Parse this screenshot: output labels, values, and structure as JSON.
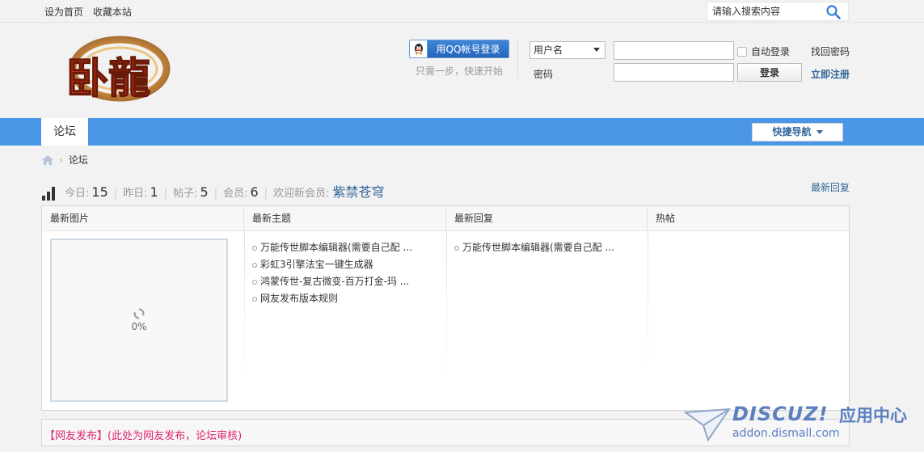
{
  "topbar": {
    "links": [
      "设为首页",
      "收藏本站"
    ],
    "search_placeholder": "请输入搜索内容"
  },
  "header": {
    "logo_text": "卧龍",
    "qq_login_label": "用QQ帐号登录",
    "qq_hint": "只需一步，快速开始",
    "username_select": "用户名",
    "password_label": "密码",
    "auto_login_label": "自动登录",
    "login_button": "登录",
    "find_password": "找回密码",
    "register": "立即注册"
  },
  "nav": {
    "tab": "论坛",
    "quick_nav": "快捷导航"
  },
  "breadcrumb": {
    "current": "论坛"
  },
  "stats": {
    "today_label": "今日:",
    "today": "15",
    "yesterday_label": "昨日:",
    "yesterday": "1",
    "posts_label": "帖子:",
    "posts": "5",
    "members_label": "会员:",
    "members": "6",
    "welcome_label": "欢迎新会员:",
    "new_member": "紫禁苍穹",
    "latest_reply_link": "最新回复"
  },
  "panel": {
    "columns": [
      "最新图片",
      "最新主题",
      "最新回复",
      "热帖"
    ],
    "image_progress": "0%",
    "latest_topics": [
      "万能传世脚本编辑器(需要自己配 ...",
      "彩虹3引擎法宝一键生成器",
      "鸿蒙传世-复古微变-百万打金-玛 ...",
      "网友发布版本规则"
    ],
    "latest_replies": [
      "万能传世脚本编辑器(需要自己配 ..."
    ],
    "hot_posts": []
  },
  "bottom": {
    "title": "【网友发布】(此处为网友发布，论坛审核)"
  },
  "watermark": {
    "brand": "DISCUZ!",
    "cn": "应用中心",
    "url": "addon.dismall.com"
  },
  "colors": {
    "nav_blue": "#4b96e7",
    "link_blue": "#336699",
    "pink": "#e1256e"
  }
}
